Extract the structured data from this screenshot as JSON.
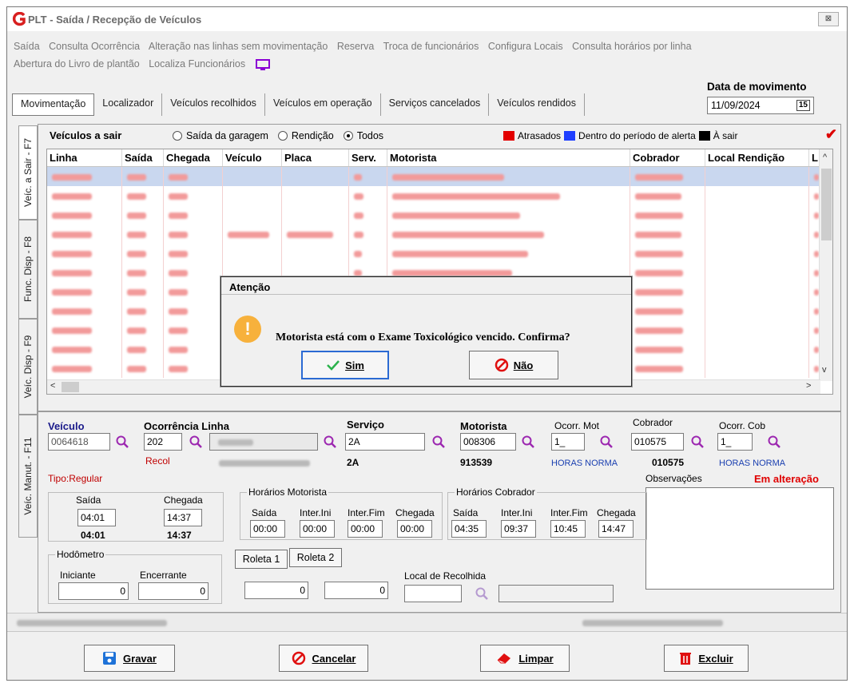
{
  "window": {
    "title": "PLT - Saída / Recepção de Veículos",
    "close_label": "⊠"
  },
  "menu": [
    "Saída",
    "Consulta Ocorrência",
    "Alteração nas linhas sem movimentação",
    "Reserva",
    "Troca de funcionários",
    "Configura Locais",
    "Consulta horários por linha",
    "Abertura do Livro de plantão",
    "Localiza Funcionários"
  ],
  "date": {
    "label": "Data de movimento",
    "value": "11/09/2024",
    "cal_icon": "15"
  },
  "tabs": [
    "Movimentação",
    "Localizador",
    "Veículos recolhidos",
    "Veículos em operação",
    "Serviços cancelados",
    "Veículos rendidos"
  ],
  "side_tabs": [
    "Veíc. a Sair - F7",
    "Func. Disp - F8",
    "Veíc. Disp - F9",
    "Veíc. Manut. - F11"
  ],
  "list": {
    "title": "Veículos a sair",
    "radios": [
      "Saída da garagem",
      "Rendição",
      "Todos"
    ],
    "legend": [
      "Atrasados",
      "Dentro do período de alerta",
      "À sair"
    ],
    "colors": {
      "atrasados": "#e30000",
      "alerta": "#1f3fff",
      "a_sair": "#000000"
    },
    "columns": [
      "Linha",
      "Saída",
      "Chegada",
      "Veículo",
      "Placa",
      "Serv.",
      "Motorista",
      "Cobrador",
      "Local Rendição",
      "L"
    ]
  },
  "form": {
    "veiculo_label": "Veículo",
    "veiculo": "0064618",
    "ocorrencia_label": "Ocorrência",
    "linha_label": "Linha",
    "ocorrencia": "202",
    "ocorrencia_sub": "Recol",
    "servico_label": "Serviço",
    "servico": "2A",
    "servico_sub": "2A",
    "motorista_label": "Motorista",
    "motorista": "008306",
    "motorista_sub": "913539",
    "ocorr_mot_label": "Ocorr. Mot",
    "ocorr_mot": "1_",
    "ocorr_mot_sub": "HORAS NORMA",
    "cobrador_label": "Cobrador",
    "cobrador": "010575",
    "cobrador_sub": "010575",
    "ocorr_cob_label": "Ocorr. Cob",
    "ocorr_cob": "1_",
    "ocorr_cob_sub": "HORAS NORMA",
    "tipo": "Tipo:Regular",
    "saida_label": "Saída",
    "saida": "04:01",
    "saida_sub": "04:01",
    "chegada_label": "Chegada",
    "chegada": "14:37",
    "chegada_sub": "14:37",
    "horarios_motorista": {
      "label": "Horários Motorista",
      "saida": "00:00",
      "inter_ini": "00:00",
      "inter_fim": "00:00",
      "chegada": "00:00"
    },
    "horarios_cobrador": {
      "label": "Horários Cobrador",
      "saida": "04:35",
      "inter_ini": "09:37",
      "inter_fim": "10:45",
      "chegada": "14:47"
    },
    "col_saida": "Saída",
    "col_inter_ini": "Inter.Ini",
    "col_inter_fim": "Inter.Fim",
    "col_chegada": "Chegada",
    "observacoes_label": "Observações",
    "em_alteracao": "Em alteração",
    "hodometro_label": "Hodômetro",
    "iniciante_label": "Iniciante",
    "iniciante": "0",
    "encerrante_label": "Encerrante",
    "encerrante": "0",
    "roleta1": "Roleta 1",
    "roleta2": "Roleta 2",
    "roleta1_val": "0",
    "roleta2_val": "0",
    "local_recolhida_label": "Local de Recolhida"
  },
  "buttons": {
    "gravar": "Gravar",
    "cancelar": "Cancelar",
    "limpar": "Limpar",
    "excluir": "Excluir"
  },
  "dialog": {
    "title": "Atenção",
    "message": "Motorista está com o Exame Toxicológico vencido. Confirma?",
    "yes": "Sim",
    "no": "Não"
  }
}
